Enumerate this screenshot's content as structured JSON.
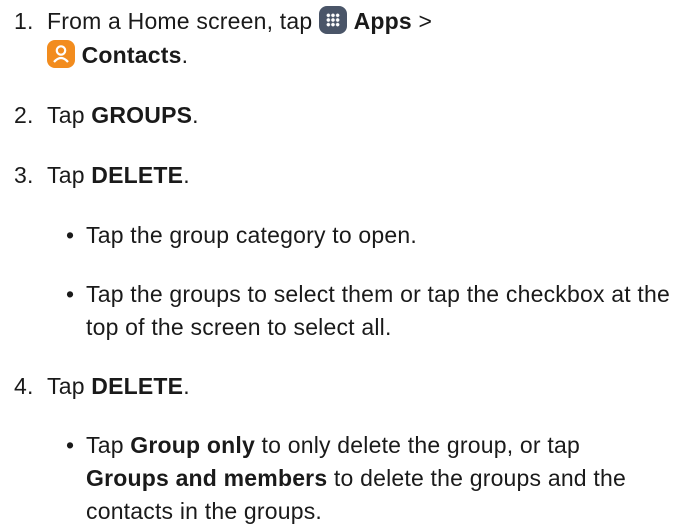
{
  "steps": [
    {
      "number": "1.",
      "text_before": "From a Home screen, tap",
      "apps_icon": "apps-grid-icon",
      "apps_label": "Apps",
      "separator": ">",
      "contacts_icon": "contacts-person-icon",
      "contacts_label": "Contacts",
      "end": "."
    },
    {
      "number": "2.",
      "prefix": "Tap",
      "bold": "GROUPS",
      "end": "."
    },
    {
      "number": "3.",
      "prefix": "Tap",
      "bold": "DELETE",
      "end": ".",
      "bullets": [
        "Tap the group category to open.",
        "Tap the groups to select them or tap the checkbox at the top of the screen to select all."
      ]
    },
    {
      "number": "4.",
      "prefix": "Tap",
      "bold": "DELETE",
      "end": ".",
      "bullet": {
        "prefix": "Tap",
        "opt1": "Group only",
        "mid": "to only delete the group, or tap",
        "opt2": "Groups and members",
        "suffix": "to delete the groups and the contacts in the groups."
      }
    }
  ],
  "bullet_glyph": "•",
  "colors": {
    "apps_icon": "#4a5568",
    "contacts_icon": "#f28c1e",
    "text": "#1a1a1a"
  }
}
